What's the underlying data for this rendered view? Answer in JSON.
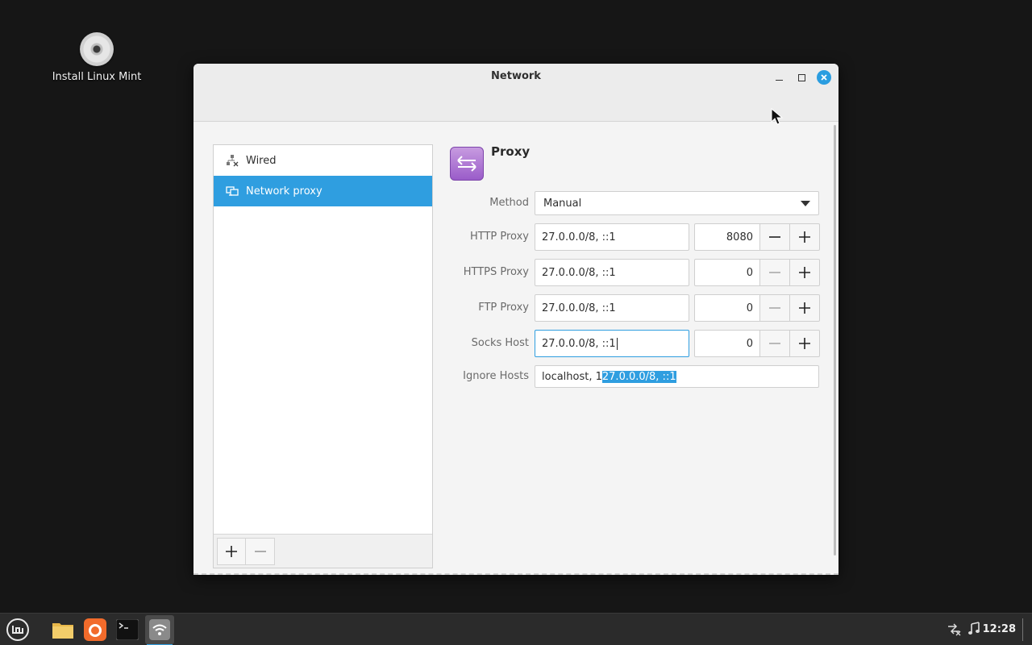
{
  "desktop": {
    "icon_label": "Install Linux Mint"
  },
  "window": {
    "title": "Network"
  },
  "sidebar": {
    "items": [
      {
        "label": "Wired",
        "icon": "wired-network-icon",
        "active": false
      },
      {
        "label": "Network proxy",
        "icon": "network-proxy-icon",
        "active": true
      }
    ],
    "add_label": "+",
    "remove_label": "−"
  },
  "proxy": {
    "title": "Proxy",
    "method_label": "Method",
    "method_value": "Manual",
    "http": {
      "label": "HTTP Proxy",
      "host": "27.0.0.0/8, ::1",
      "port": "8080"
    },
    "https": {
      "label": "HTTPS Proxy",
      "host": "27.0.0.0/8, ::1",
      "port": "0"
    },
    "ftp": {
      "label": "FTP Proxy",
      "host": "27.0.0.0/8, ::1",
      "port": "0"
    },
    "socks": {
      "label": "Socks Host",
      "host": "27.0.0.0/8, ::1",
      "port": "0"
    },
    "ignore": {
      "label": "Ignore Hosts",
      "prefix": "localhost, 1",
      "selected": "27.0.0.0/8, ::1"
    }
  },
  "taskbar": {
    "clock": "12:28",
    "apps": [
      "menu-icon",
      "files-icon",
      "firefox-icon",
      "terminal-icon",
      "network-icon"
    ]
  },
  "colors": {
    "accent": "#2f9ee0",
    "desktop_bg": "#161616",
    "taskbar_bg": "#2b2b2b"
  }
}
